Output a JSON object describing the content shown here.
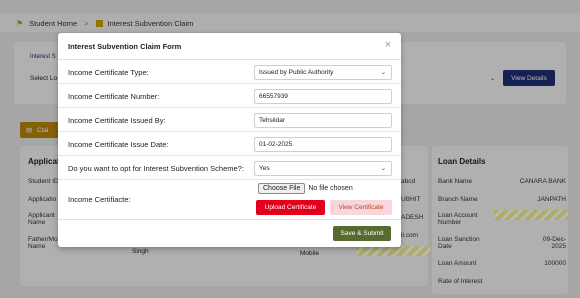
{
  "breadcrumb": {
    "home_label": "Student Home",
    "separator": ">",
    "current_label": "Interest Subvention Claim"
  },
  "background": {
    "interest_card_title": "Interest S",
    "select_label": "Select Lo",
    "view_details_label": "View Details",
    "claim_button_label": "Clai",
    "applicant_section_title": "Applicati",
    "applicant_fields": [
      {
        "label": "Student ID"
      },
      {
        "label": "Applicatio"
      },
      {
        "label": "Applicant\nName"
      },
      {
        "label": "Father/Mo\nName",
        "value": "Singh"
      }
    ],
    "middle_values": [
      "abcd",
      "UBHIT",
      "ADESH",
      "il.com"
    ],
    "mobile_label": "Mobile",
    "loan_details": {
      "title": "Loan Details",
      "rows": [
        {
          "label": "Bank Name",
          "value": "CANARA BANK"
        },
        {
          "label": "Branch Name",
          "value": "JANPATH"
        },
        {
          "label": "Loan Account\nNumber",
          "value": ""
        },
        {
          "label": "Loan Sanction\nDate",
          "value": "09-Dec-\n2025"
        },
        {
          "label": "Loan Amount",
          "value": "100000"
        },
        {
          "label": "Rate of Interest",
          "value": ""
        }
      ]
    }
  },
  "modal": {
    "title": "Interest Subvention Claim Form",
    "close_symbol": "×",
    "fields": {
      "cert_type": {
        "label": "Income Certificate Type:",
        "value": "Issued by Public Authority"
      },
      "cert_number": {
        "label": "Income Certificate Number:",
        "value": "66557939"
      },
      "issued_by": {
        "label": "Income Certificate Issued By:",
        "value": "Tehsildar"
      },
      "issue_date": {
        "label": "Income Certificate Issue Date:",
        "value": "01-02-2025"
      },
      "opt_in": {
        "label": "Do you want to opt for Interest Subvention Scheme?:",
        "value": "Yes"
      },
      "certificate": {
        "label": "Income Certifiacte:",
        "choose_file_label": "Choose File",
        "file_status": "No file chosen"
      }
    },
    "upload_label": "Upload Certificate",
    "view_certificate_label": "View Certificate",
    "submit_label": "Save & Submit"
  },
  "colors": {
    "primary": "#1f2f73",
    "submit": "#556b2f",
    "upload": "#e3001b",
    "view_certificate_bg": "#f8d7da",
    "accent": "#c8a200"
  }
}
